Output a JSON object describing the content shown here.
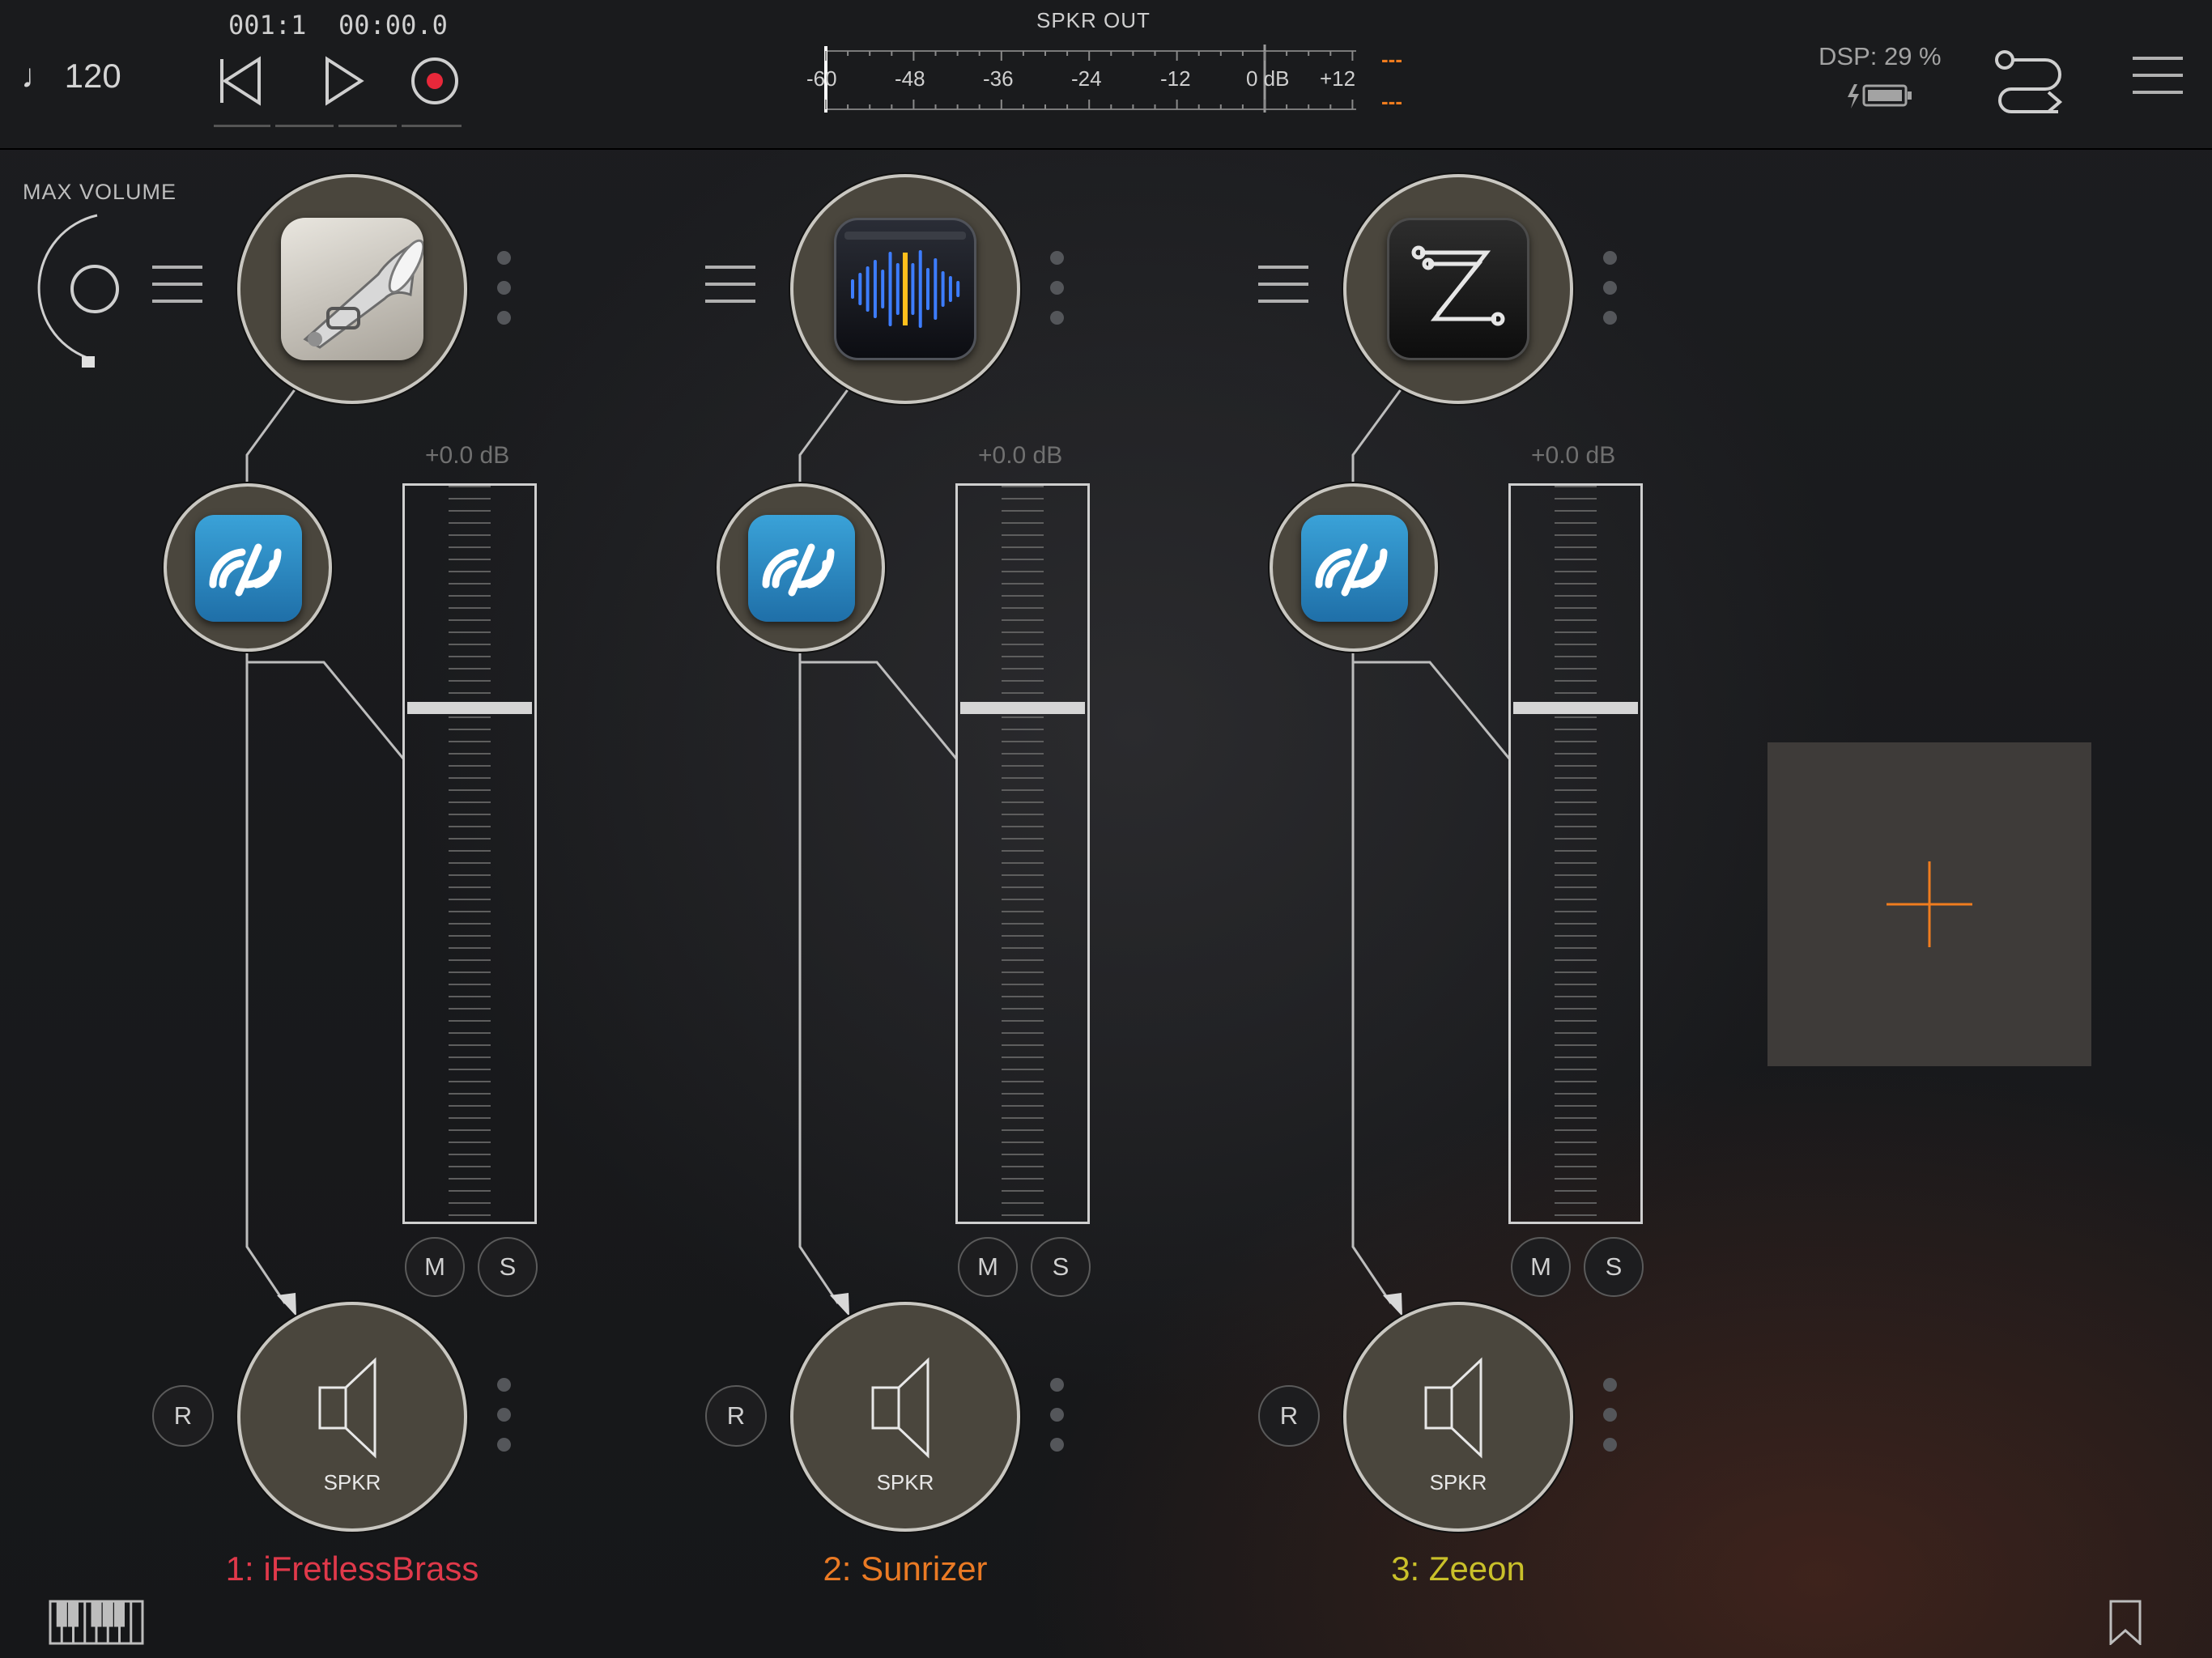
{
  "topbar": {
    "tempo": "♩ 120",
    "bar_position": "001:1",
    "time_position": "00:00.0",
    "meter": {
      "title": "SPKR OUT",
      "scale": [
        "-60",
        "-48",
        "-36",
        "-24",
        "-12",
        "0 dB",
        "+12"
      ],
      "peak_top": "---",
      "peak_bottom": "---"
    },
    "dsp": "DSP: 29 %"
  },
  "max_volume": {
    "label": "MAX VOLUME"
  },
  "channels": [
    {
      "name": "1: iFretlessBrass",
      "color": "#e0394a",
      "fader_label": "+0.0 dB",
      "mute": "M",
      "solo": "S",
      "record": "R",
      "output": "SPKR",
      "instrument_icon": "trumpet-icon",
      "effect_icon": "wifi-audio-icon"
    },
    {
      "name": "2: Sunrizer",
      "color": "#ea7a24",
      "fader_label": "+0.0 dB",
      "mute": "M",
      "solo": "S",
      "record": "R",
      "output": "SPKR",
      "instrument_icon": "waveform-icon",
      "effect_icon": "wifi-audio-icon"
    },
    {
      "name": "3: Zeeon",
      "color": "#c9c02a",
      "fader_label": "+0.0 dB",
      "mute": "M",
      "solo": "S",
      "record": "R",
      "output": "SPKR",
      "instrument_icon": "z-circuit-icon",
      "effect_icon": "wifi-audio-icon"
    }
  ],
  "colors": {
    "accent": "#f07c1e",
    "circle_fill": "#4a463d",
    "circle_border": "#c9c7c1"
  }
}
